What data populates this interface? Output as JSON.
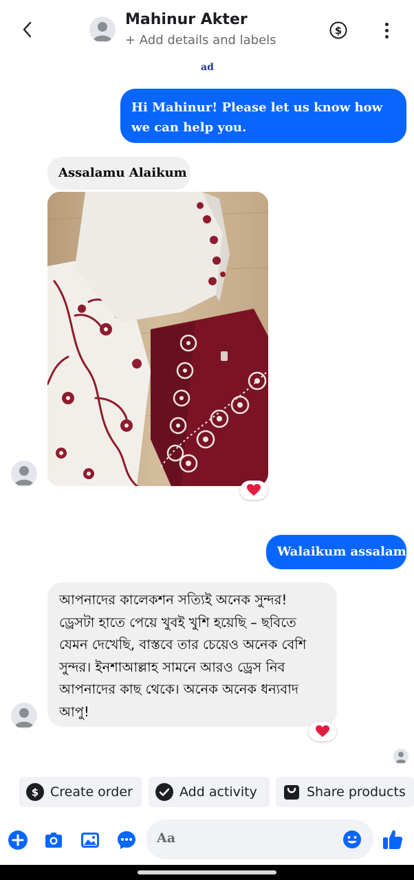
{
  "header": {
    "contact_name": "Mahinur Akter",
    "subtitle": "+ Add details and labels",
    "back_icon": "chevron-left-icon",
    "payment_icon": "dollar-circle-icon",
    "more_icon": "more-vertical-icon"
  },
  "ad_tag": "ad",
  "messages": [
    {
      "direction": "outgoing",
      "text": "Hi Mahinur! Please let us know how we can help you."
    },
    {
      "direction": "incoming",
      "text": "Assalamu Alaikum"
    },
    {
      "direction": "incoming",
      "type": "image",
      "reaction": "❤️"
    },
    {
      "direction": "outgoing",
      "text": "Walaikum assalam"
    },
    {
      "direction": "incoming",
      "text": "আপনাদের কালেকশন সত্যিই অনেক সুন্দর! ড্রেসটা হাতে পেয়ে খুবই খুশি হয়েছি – ছবিতে যেমন দেখেছি, বাস্তবে তার চেয়েও অনেক বেশি সুন্দর। ইনশাআল্লাহ সামনে আরও ড্রেস নিব আপনাদের কাছ থেকে। অনেক অনেক ধন্যবাদ আপু!",
      "reaction": "❤️"
    }
  ],
  "actions": [
    {
      "label": "Create order",
      "icon": "dollar-circle-icon"
    },
    {
      "label": "Add activity",
      "icon": "check-circle-icon"
    },
    {
      "label": "Share products",
      "icon": "shopping-bag-icon"
    }
  ],
  "composer": {
    "placeholder": "Aa",
    "icons": [
      "plus-icon",
      "camera-icon",
      "gallery-icon",
      "chat-bubble-icon",
      "emoji-icon",
      "like-icon"
    ]
  },
  "colors": {
    "brand_blue": "#0866ff",
    "incoming_bubble": "#f0f0f0",
    "heart": "#e41e3f"
  }
}
